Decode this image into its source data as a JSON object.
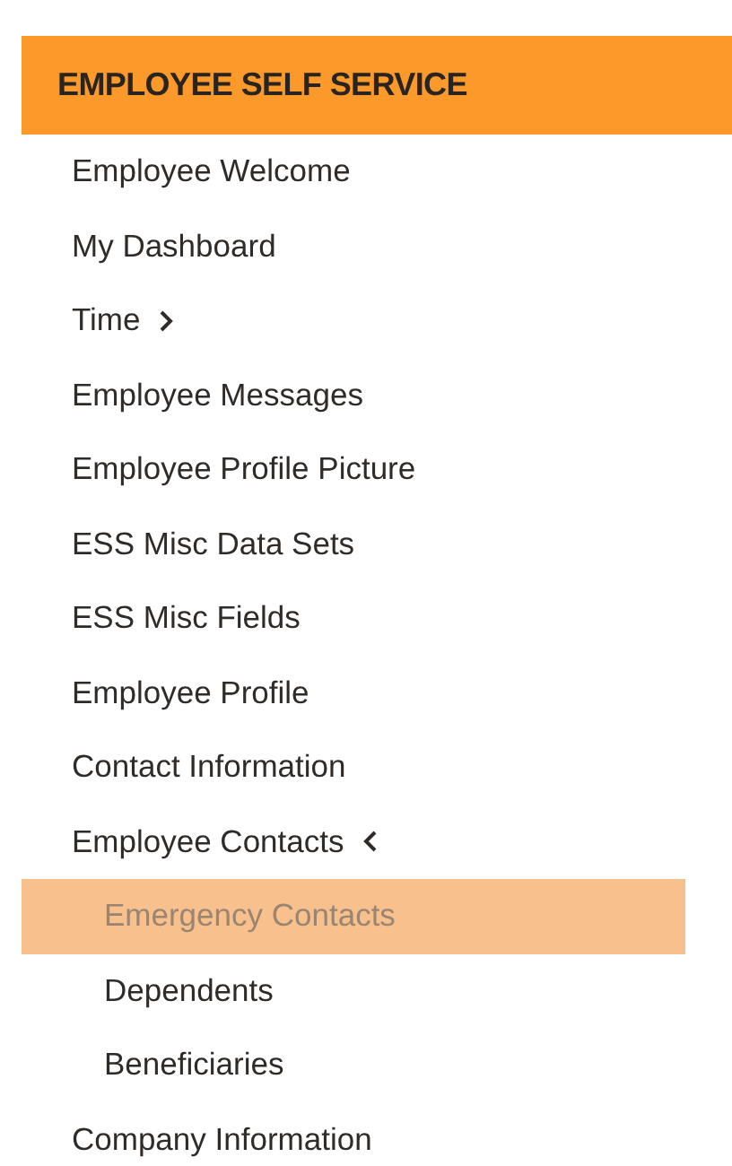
{
  "header": {
    "title": "EMPLOYEE SELF SERVICE"
  },
  "items": [
    {
      "label": "Employee Welcome",
      "selected": false
    },
    {
      "label": "My Dashboard",
      "selected": false
    },
    {
      "label": "Time",
      "expanded": false,
      "selected": false
    },
    {
      "label": "Employee Messages",
      "selected": false
    },
    {
      "label": "Employee Profile Picture",
      "selected": false
    },
    {
      "label": "ESS Misc Data Sets",
      "selected": false
    },
    {
      "label": "ESS Misc Fields",
      "selected": false
    },
    {
      "label": "Employee Profile",
      "selected": false
    },
    {
      "label": "Contact Information",
      "selected": false
    },
    {
      "label": "Employee Contacts",
      "expanded": true,
      "selected": false,
      "children": [
        {
          "label": "Emergency Contacts",
          "selected": true
        },
        {
          "label": "Dependents",
          "selected": false
        },
        {
          "label": "Beneficiaries",
          "selected": false
        }
      ]
    },
    {
      "label": "Company Information",
      "selected": false
    }
  ]
}
